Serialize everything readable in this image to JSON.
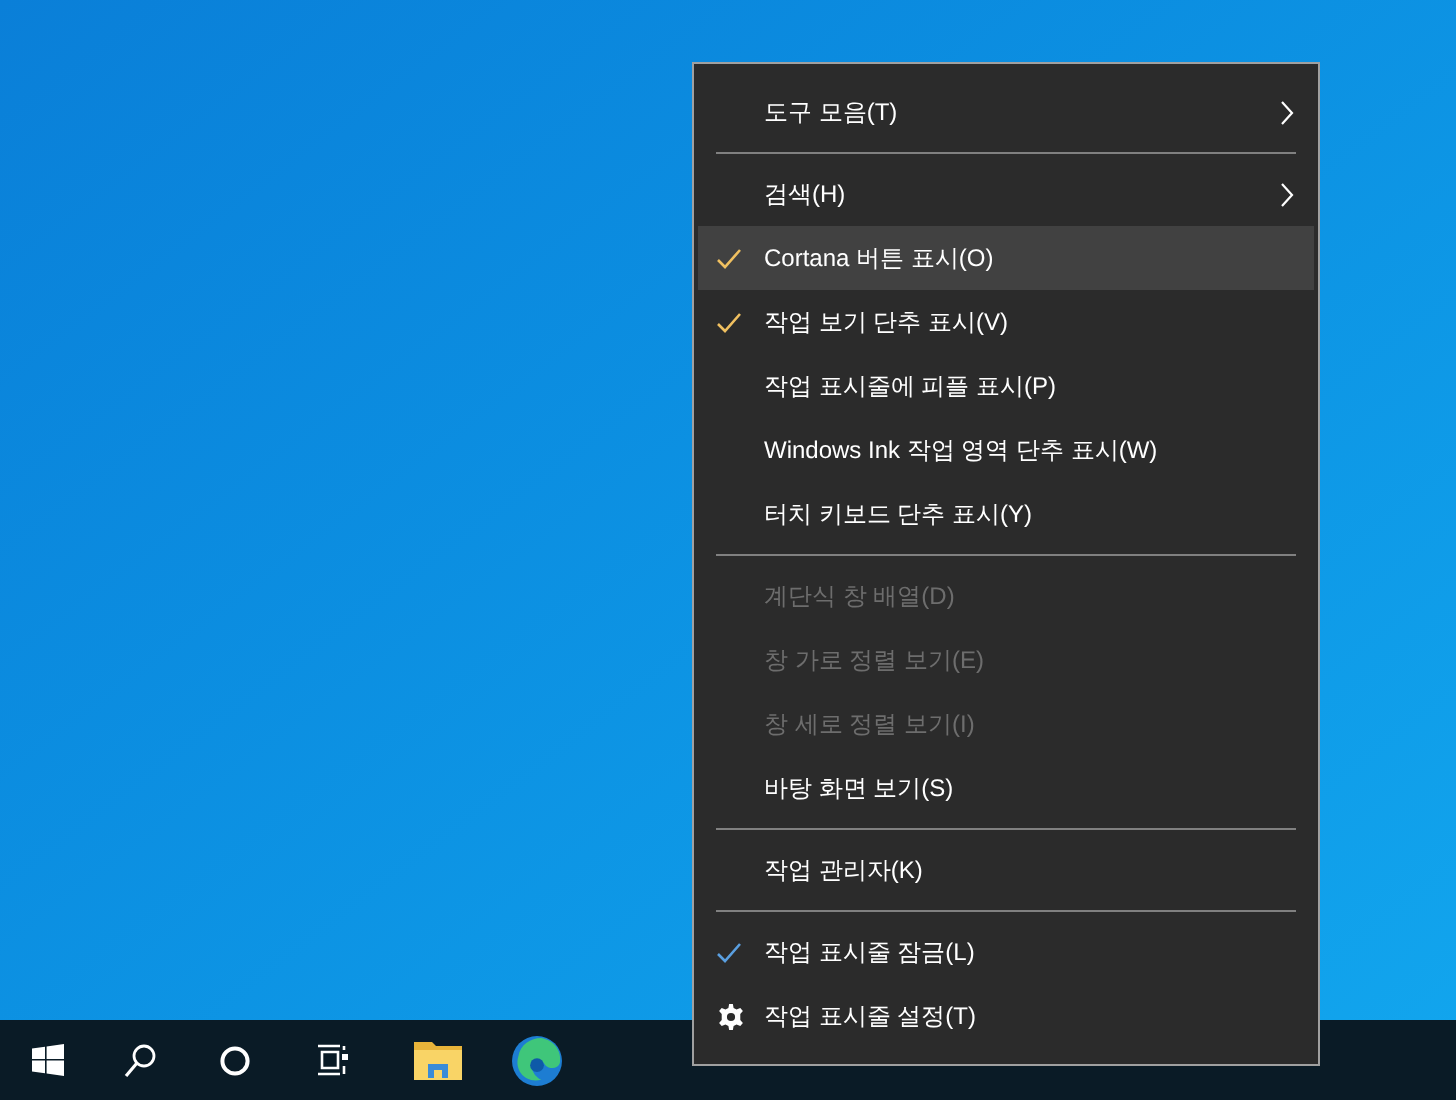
{
  "context_menu": {
    "items": [
      {
        "kind": "submenu",
        "label": "도구 모음(T)",
        "checked": false,
        "selected": false,
        "disabled": false
      },
      {
        "kind": "separator"
      },
      {
        "kind": "submenu",
        "label": "검색(H)",
        "checked": false,
        "selected": false,
        "disabled": false
      },
      {
        "kind": "item",
        "label": "Cortana 버튼 표시(O)",
        "checked": true,
        "color": "#f0c060",
        "selected": true,
        "disabled": false
      },
      {
        "kind": "item",
        "label": "작업 보기 단추 표시(V)",
        "checked": true,
        "color": "#f0c060",
        "selected": false,
        "disabled": false
      },
      {
        "kind": "item",
        "label": "작업 표시줄에 피플 표시(P)",
        "checked": false,
        "selected": false,
        "disabled": false
      },
      {
        "kind": "item",
        "label": "Windows Ink 작업 영역 단추 표시(W)",
        "checked": false,
        "selected": false,
        "disabled": false
      },
      {
        "kind": "item",
        "label": "터치 키보드 단추 표시(Y)",
        "checked": false,
        "selected": false,
        "disabled": false
      },
      {
        "kind": "separator"
      },
      {
        "kind": "item",
        "label": "계단식 창 배열(D)",
        "checked": false,
        "selected": false,
        "disabled": true
      },
      {
        "kind": "item",
        "label": "창 가로 정렬 보기(E)",
        "checked": false,
        "selected": false,
        "disabled": true
      },
      {
        "kind": "item",
        "label": "창 세로 정렬 보기(I)",
        "checked": false,
        "selected": false,
        "disabled": true
      },
      {
        "kind": "item",
        "label": "바탕 화면 보기(S)",
        "checked": false,
        "selected": false,
        "disabled": false
      },
      {
        "kind": "separator"
      },
      {
        "kind": "item",
        "label": "작업 관리자(K)",
        "checked": false,
        "selected": false,
        "disabled": false
      },
      {
        "kind": "separator"
      },
      {
        "kind": "item",
        "label": "작업 표시줄 잠금(L)",
        "checked": true,
        "color": "#5a9fe0",
        "selected": false,
        "disabled": false
      },
      {
        "kind": "settings",
        "label": "작업 표시줄 설정(T)",
        "checked": false,
        "selected": false,
        "disabled": false
      }
    ]
  }
}
